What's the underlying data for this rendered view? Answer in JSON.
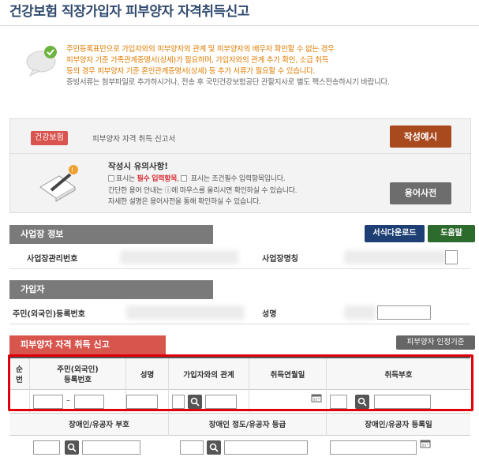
{
  "page": {
    "title": "건강보험 직장가입자 피부양자 자격취득신고"
  },
  "notice": {
    "line1": "주민등록표만으로 가입자와의 피부양자의 관계 및 피부양자의 배우자 확인할 수 없는 경우",
    "line2": "피부양자 기준 가족관계증명서(상세)가 필요하며, 가입자와의 관계 추가 확인, 소급 취득",
    "line3": "등의 경우 피부양자 기준 혼인관계증명서(상세) 등 추가 서류가 필요할 수 있습니다.",
    "line4": "증빙서류는 첨부파일로 추가하시거나, 전송 후 국민건강보험공단 관할지사로 별도 팩스전송하시기 바랍니다."
  },
  "doc": {
    "badge": "건강보험",
    "form_name": "피부양자 자격 취득 신고서",
    "example_button": "작성예시",
    "tips_title": "작성시 유의사항!",
    "tips_line1_a": "표시는 ",
    "tips_line1_b": "필수 입력항목",
    "tips_line1_c": ", ",
    "tips_line1_d": " 표시는 조건필수 입력항목입니다.",
    "tips_line2": "간단한 용어 안내는 ⓘ에 마우스를 올리시면 확인하실 수 있습니다.",
    "tips_line3": "자세한 설명은 용어사전을 통해 확인하실 수 있습니다.",
    "dict_button": "용어사전"
  },
  "business": {
    "header": "사업장 정보",
    "download_button": "서식다운로드",
    "help_button": "도움말",
    "mgmt_no_label": "사업장관리번호",
    "name_label": "사업장명칭"
  },
  "subscriber": {
    "header": "가입자",
    "rrn_label": "주민(외국인)등록번호",
    "name_label": "성명"
  },
  "dependent": {
    "header": "피부양자 자격 취득 신고",
    "criteria_button": "피부양자 인정기준",
    "columns": [
      "순번",
      "주민(외국인)\n등록번호",
      "성명",
      "가입자와의 관계",
      "취득연월일",
      "취득부호"
    ],
    "seq_label": "순\n번",
    "rrn_dash": "–",
    "columns2": [
      "장애인/유공자 부호",
      "장애인 정도/유공자 등급",
      "장애인/유공자 등록일"
    ]
  }
}
